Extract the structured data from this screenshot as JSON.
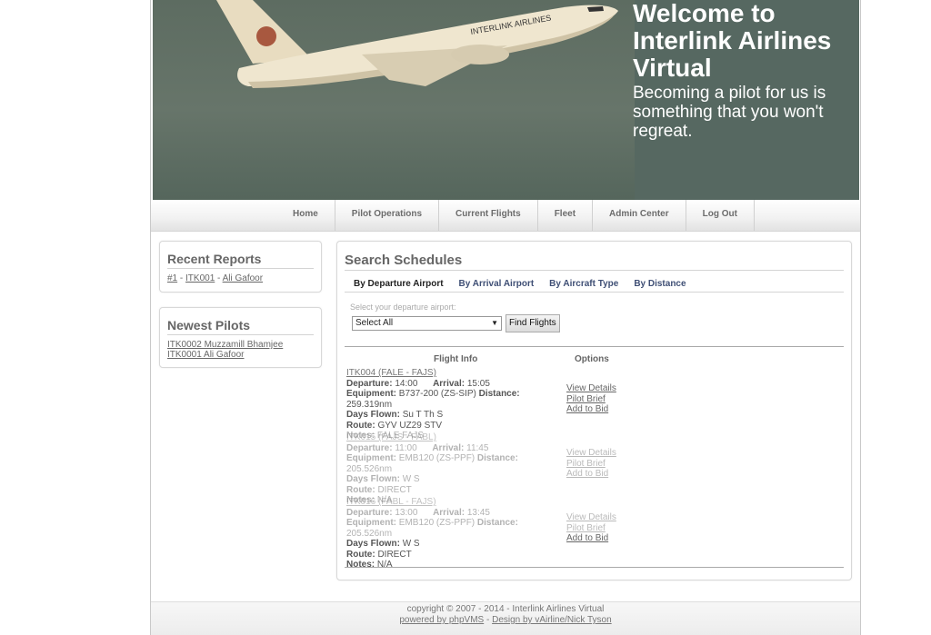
{
  "banner": {
    "title": "Welcome to Interlink Airlines Virtual",
    "subtitle": "Becoming a pilot for us is something that you won't regreat.",
    "plane_text": "INTERLINK AIRLINES"
  },
  "nav": [
    "Home",
    "Pilot Operations",
    "Current Flights",
    "Fleet",
    "Admin Center",
    "Log Out"
  ],
  "recent_reports": {
    "title": "Recent Reports",
    "items": [
      {
        "num": "#1",
        "pilot": "ITK001",
        "name": "Ali Gafoor"
      }
    ],
    "sep": " - "
  },
  "newest_pilots": {
    "title": "Newest Pilots",
    "items": [
      "ITK0002 Muzzamill Bhamjee",
      "ITK0001 Ali Gafoor"
    ]
  },
  "search": {
    "title": "Search Schedules",
    "tabs": [
      "By Departure Airport",
      "By Arrival Airport",
      "By Aircraft Type",
      "By Distance"
    ],
    "dep_label": "Select your departure airport:",
    "dep_value": "Select All",
    "find_button": "Find Flights",
    "col_flight": "Flight Info",
    "col_options": "Options",
    "labels": {
      "departure": "Departure:",
      "arrival": "Arrival:",
      "equipment": "Equipment:",
      "distance": "Distance:",
      "days": "Days Flown:",
      "route": "Route:",
      "notes": "Notes:"
    },
    "options": {
      "details": "View Details",
      "brief": "Pilot Brief",
      "bid": "Add to Bid"
    },
    "flights": [
      {
        "header": "ITK004 (FALE - FAJS)",
        "dep": "14:00",
        "arr": "15:05",
        "equip": "B737-200 (ZS-SIP)",
        "dist": "259.319nm",
        "days": "Su T Th S",
        "route": "GYV UZ29 STV",
        "notes": "FALE FAJS"
      },
      {
        "header": "ITK015 (FAJS - FABL)",
        "dep": "11:00",
        "arr": "11:45",
        "equip": "EMB120 (ZS-PPF)",
        "dist": "205.526nm",
        "days": "W S",
        "route": "DIRECT",
        "notes": "N/A"
      },
      {
        "header": "ITK016 (FABL - FAJS)",
        "dep": "13:00",
        "arr": "13:45",
        "equip": "EMB120 (ZS-PPF)",
        "dist": "205.526nm",
        "days": "W S",
        "route": "DIRECT",
        "notes": "N/A"
      }
    ]
  },
  "footer": {
    "copyright": "copyright © 2007 - 2014 - Interlink Airlines Virtual",
    "powered": "powered by phpVMS",
    "sep": " - ",
    "design": "Design by vAirline/Nick Tyson"
  }
}
